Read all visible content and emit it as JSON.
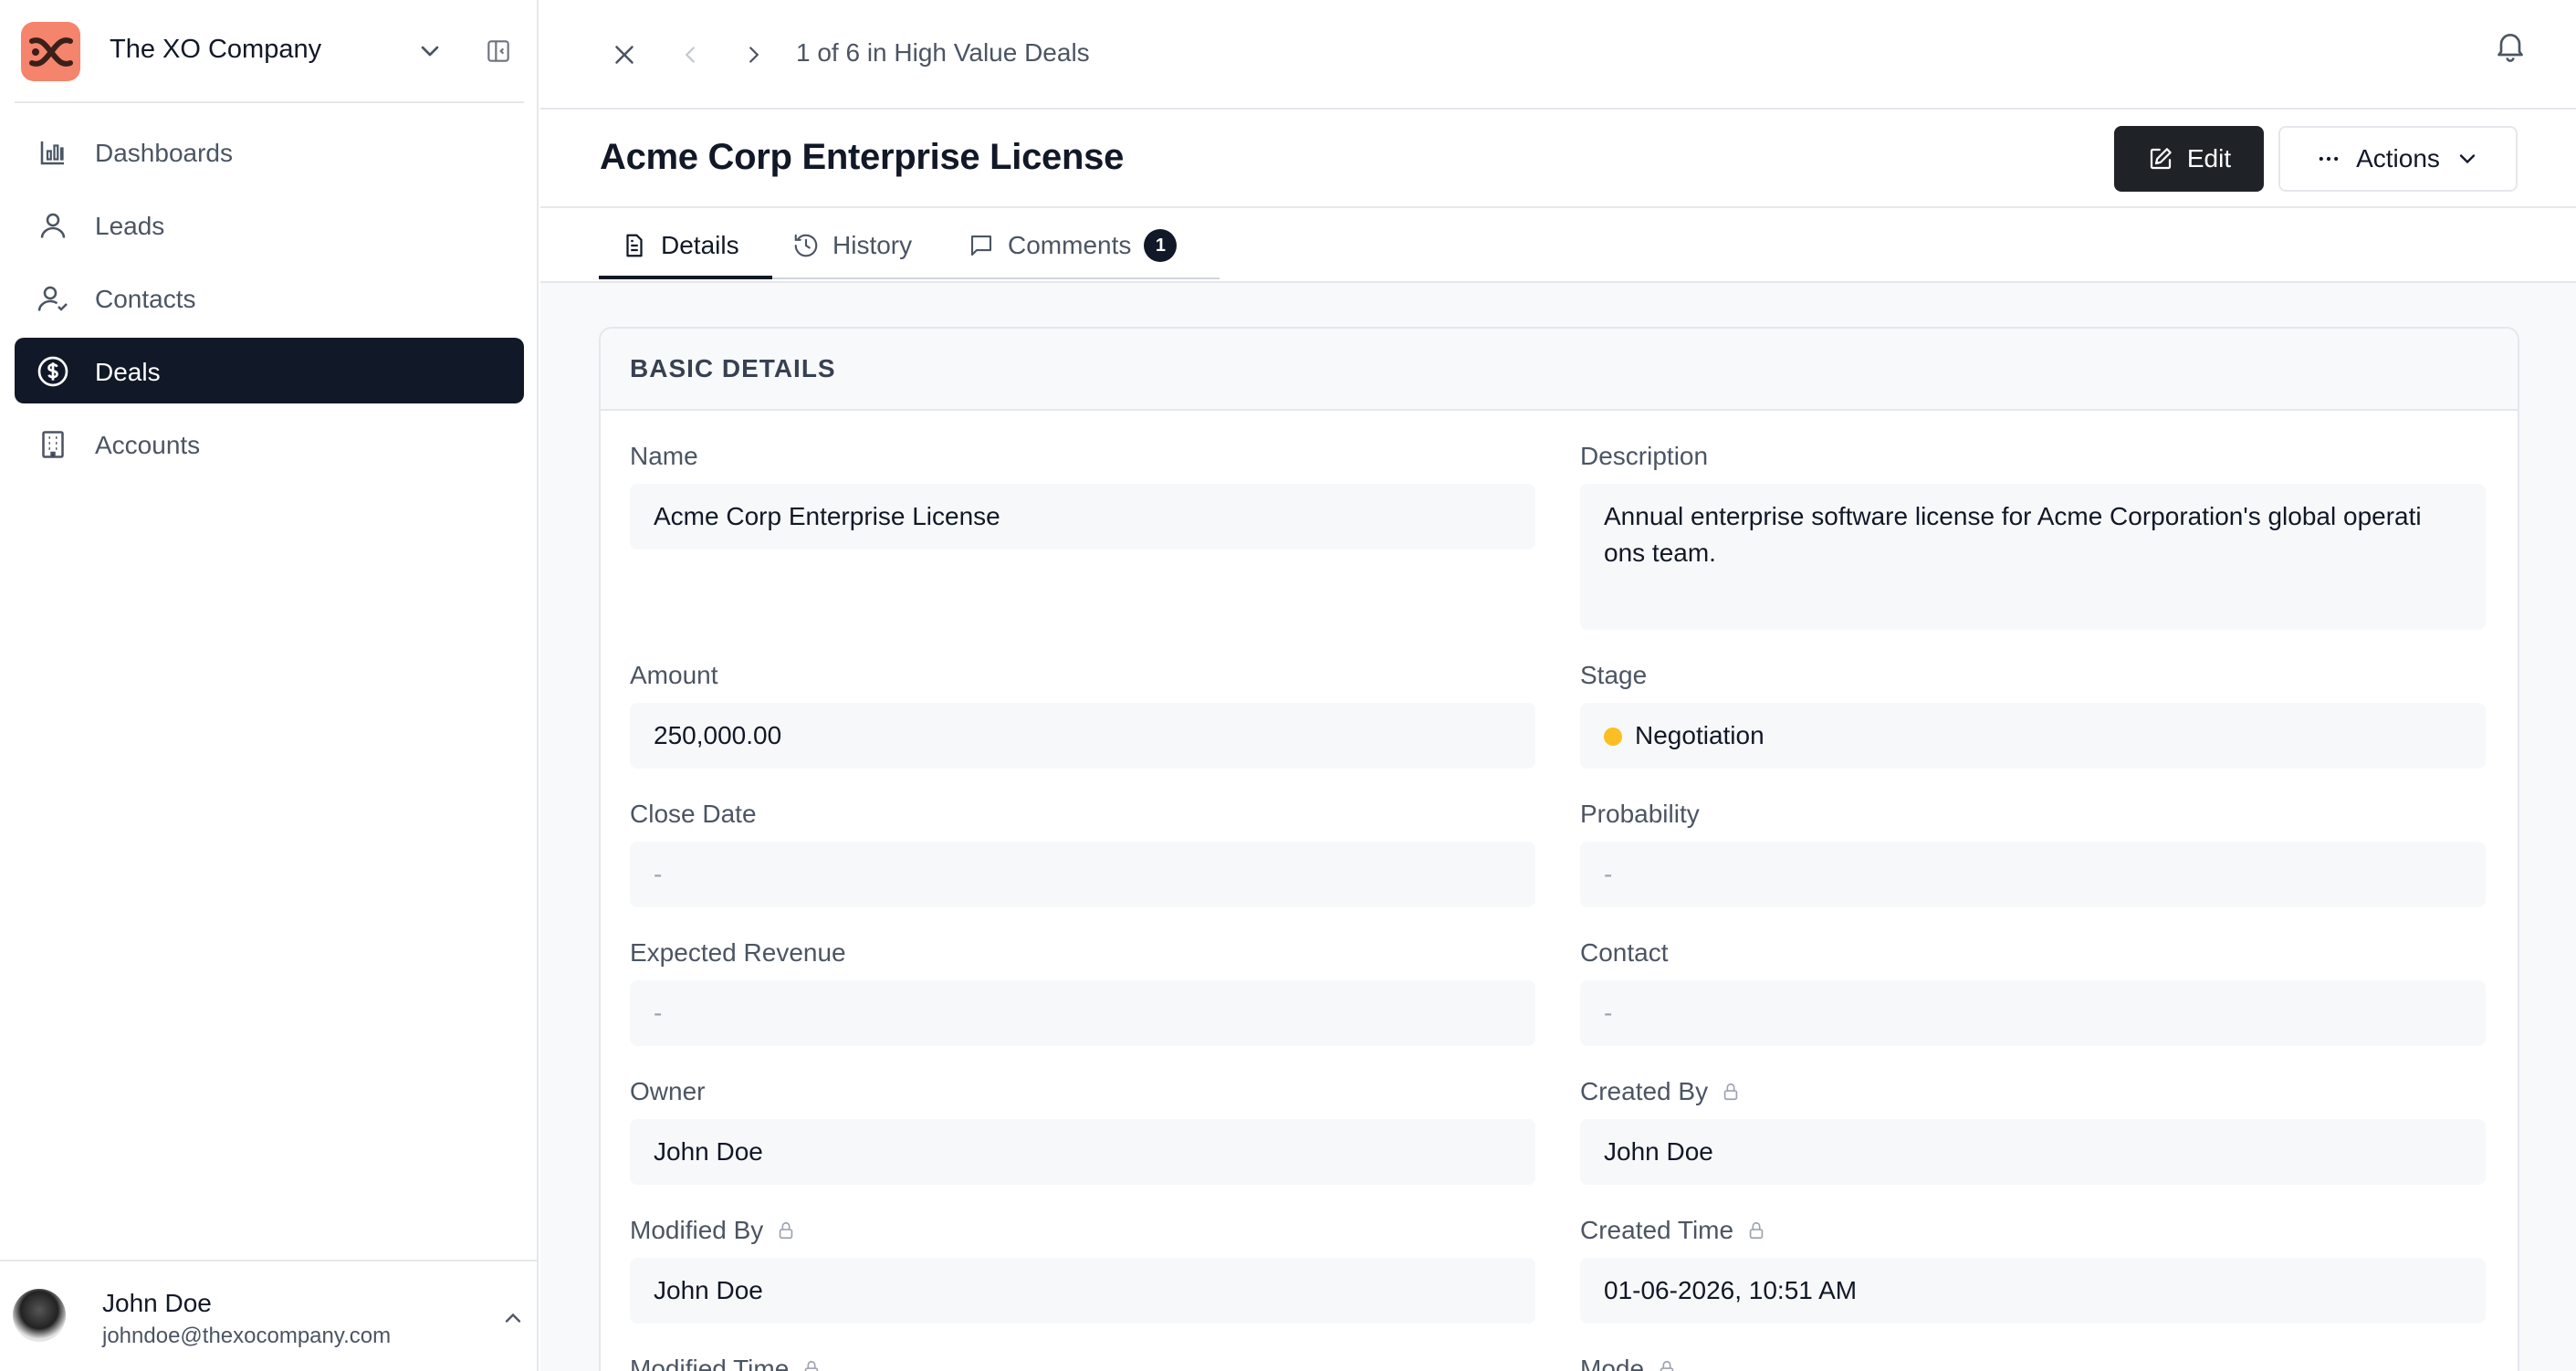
{
  "workspace": {
    "name": "The XO Company"
  },
  "sidebar": {
    "items": [
      {
        "label": "Dashboards",
        "icon": "bar-chart-icon"
      },
      {
        "label": "Leads",
        "icon": "user-icon"
      },
      {
        "label": "Contacts",
        "icon": "user-check-icon"
      },
      {
        "label": "Deals",
        "icon": "dollar-circle-icon",
        "active": true
      },
      {
        "label": "Accounts",
        "icon": "building-icon"
      }
    ]
  },
  "user": {
    "name": "John Doe",
    "email": "johndoe@thexocompany.com"
  },
  "topbar": {
    "pager": "1 of 6 in High Value Deals"
  },
  "record": {
    "title": "Acme Corp Enterprise License"
  },
  "toolbar": {
    "edit_label": "Edit",
    "actions_label": "Actions"
  },
  "tabs": [
    {
      "label": "Details"
    },
    {
      "label": "History"
    },
    {
      "label": "Comments",
      "badge": "1"
    }
  ],
  "section": {
    "title": "BASIC DETAILS"
  },
  "fields": {
    "name": {
      "label": "Name",
      "value": "Acme Corp Enterprise License"
    },
    "description": {
      "label": "Description",
      "value": "Annual enterprise software license for Acme Corporation's global operati ons team."
    },
    "amount": {
      "label": "Amount",
      "value": "250,000.00"
    },
    "stage": {
      "label": "Stage",
      "value": "Negotiation",
      "color": "#fbbf24"
    },
    "close_date": {
      "label": "Close Date",
      "value": "-"
    },
    "probability": {
      "label": "Probability",
      "value": "-"
    },
    "expected_revenue": {
      "label": "Expected Revenue",
      "value": "-"
    },
    "contact": {
      "label": "Contact",
      "value": "-"
    },
    "owner": {
      "label": "Owner",
      "value": "John Doe"
    },
    "created_by": {
      "label": "Created By",
      "value": "John Doe"
    },
    "modified_by": {
      "label": "Modified By",
      "value": "John Doe"
    },
    "created_time": {
      "label": "Created Time",
      "value": "01-06-2026, 10:51 AM"
    },
    "modified_time": {
      "label": "Modified Time"
    },
    "mode": {
      "label": "Mode"
    }
  },
  "colors": {
    "accent": "#111827",
    "logo_bg": "#f4846b",
    "stage_dot": "#fbbf24"
  }
}
